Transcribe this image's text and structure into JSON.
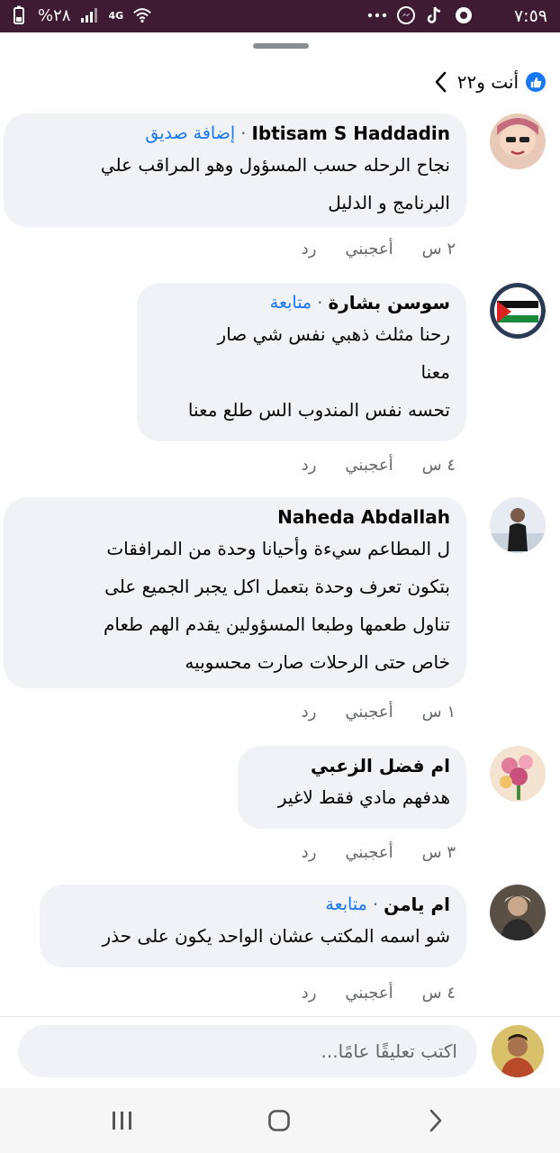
{
  "status_bar": {
    "time": "٧:٥٩",
    "battery": "%٢٨",
    "network": "4G",
    "icons": [
      "wifi-icon",
      "signal-icon",
      "battery-icon",
      "tiktok-icon",
      "messenger-icon",
      "more-dots-icon"
    ]
  },
  "header": {
    "reactions_label": "أنت و٢٢",
    "reaction_icon": "like-icon"
  },
  "comments": [
    {
      "author": "Ibtisam S Haddadin",
      "tag": "إضافة صديق",
      "lines": [
        "نجاح الرحله حسب المسؤول وهو المراقب علي",
        "البرنامج  و الدليل"
      ],
      "time": "٢ س",
      "like": "أعجبني",
      "reply": "رد"
    },
    {
      "author": "سوسن بشارة",
      "tag": "متابعة",
      "lines": [
        "رحنا مثلث ذهبي نفس شي صار",
        "معنا",
        "تحسه نفس المندوب الس طلع معنا"
      ],
      "time": "٤ س",
      "like": "أعجبني",
      "reply": "رد"
    },
    {
      "author": "Naheda Abdallah",
      "tag": "",
      "lines": [
        "ل المطاعم سيءة وأحيانا وحدة من المرافقات",
        "بتكون تعرف وحدة بتعمل اكل يجبر الجميع على",
        "تناول طعمها وطبعا المسؤولين يقدم الهم طعام",
        "خاص حتى الرحلات صارت محسوبيه"
      ],
      "time": "١ س",
      "like": "أعجبني",
      "reply": "رد"
    },
    {
      "author": "ام فضل الزعبي",
      "tag": "",
      "lines": [
        "هدفهم مادي فقط لاغير"
      ],
      "time": "٣ س",
      "like": "أعجبني",
      "reply": "رد"
    },
    {
      "author": "ام يامن",
      "tag": "متابعة",
      "lines": [
        "شو اسمه المكتب عشان الواحد يكون على حذر"
      ],
      "time": "٤ س",
      "like": "أعجبني",
      "reply": "رد"
    }
  ],
  "composer": {
    "placeholder": "اكتب تعليقًا عامًا..."
  },
  "nav": {
    "icons": [
      "recent-apps-icon",
      "home-icon",
      "back-icon"
    ]
  },
  "colors": {
    "status_bar": "#3f1a33",
    "bubble": "#f0f2f5",
    "link_blue": "#1877f2",
    "meta_gray": "#65676b"
  }
}
